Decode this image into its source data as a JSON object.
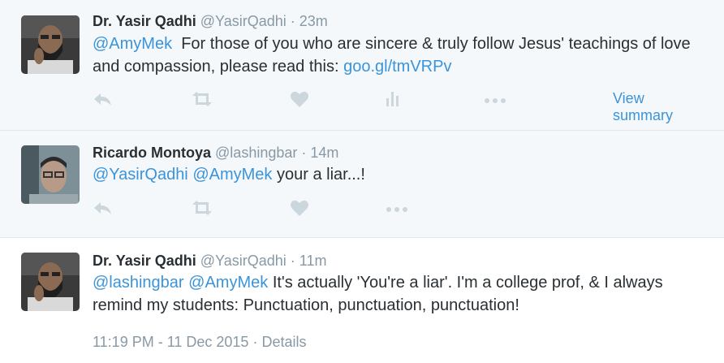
{
  "tweets": [
    {
      "fullname": "Dr. Yasir Qadhi",
      "username": "@YasirQadhi",
      "sep": "·",
      "time": "23m",
      "mention1": "@AmyMek",
      "text_pre": "For those of you who are sincere & truly follow Jesus' teachings of love and compassion, please read this: ",
      "link": "goo.gl/tmVRPv",
      "view_summary": "View summary"
    },
    {
      "fullname": "Ricardo Montoya",
      "username": "@lashingbar",
      "sep": "·",
      "time": "14m",
      "mention1": "@YasirQadhi",
      "mention2": "@AmyMek",
      "text": "your a liar...!"
    },
    {
      "fullname": "Dr. Yasir Qadhi",
      "username": "@YasirQadhi",
      "sep": "·",
      "time": "11m",
      "mention1": "@lashingbar",
      "mention2": "@AmyMek",
      "text": "It's actually 'You're a liar'. I'm a college prof, & I always remind my students: Punctuation, punctuation, punctuation!",
      "timestamp": "11:19 PM - 11 Dec 2015",
      "sep2": "·",
      "details": "Details"
    }
  ],
  "colors": {
    "link": "#3b94d9",
    "muted": "#8899a6",
    "icon": "#ccd6dd",
    "text": "#292f33"
  },
  "icons": [
    "reply-icon",
    "retweet-icon",
    "like-icon",
    "analytics-icon",
    "more-icon"
  ]
}
